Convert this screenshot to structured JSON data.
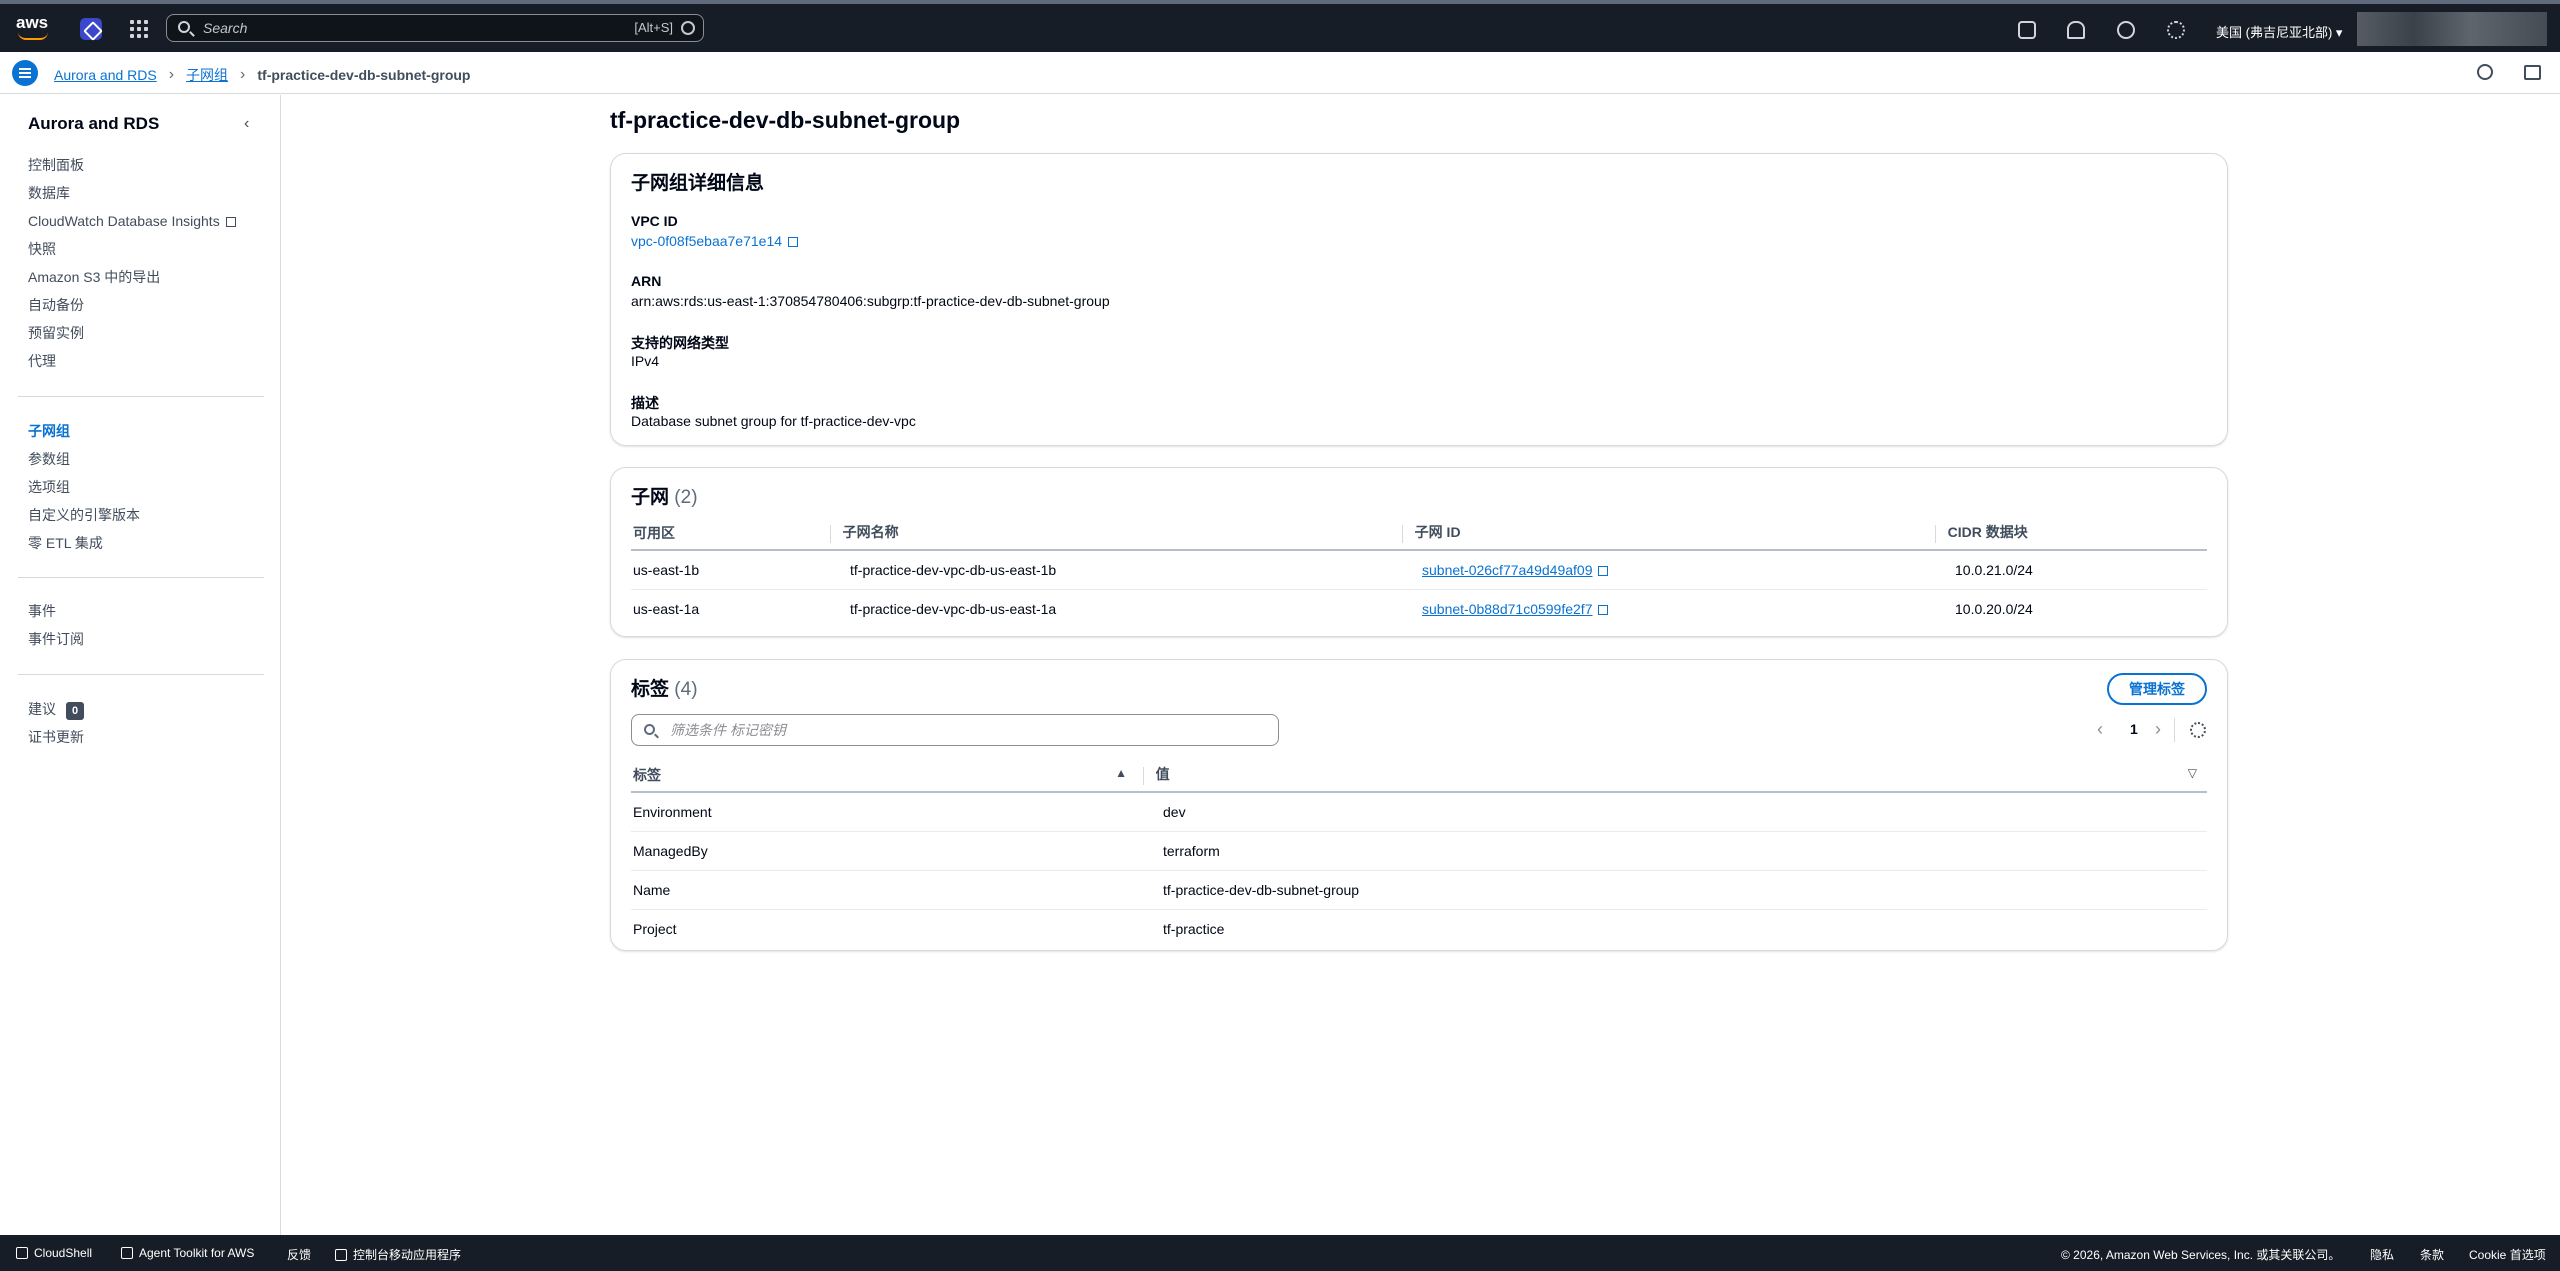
{
  "topnav": {
    "logo_text": "aws",
    "search_placeholder": "Search",
    "search_shortcut": "[Alt+S]",
    "region": "美国 (弗吉尼亚北部)"
  },
  "breadcrumb": {
    "items": [
      "Aurora and RDS",
      "子网组"
    ],
    "current": "tf-practice-dev-db-subnet-group"
  },
  "sidebar": {
    "title": "Aurora and RDS",
    "group1": [
      "控制面板",
      "数据库",
      "CloudWatch Database Insights",
      "快照",
      "Amazon S3 中的导出",
      "自动备份",
      "预留实例",
      "代理"
    ],
    "group2": [
      "子网组",
      "参数组",
      "选项组",
      "自定义的引擎版本",
      "零 ETL 集成"
    ],
    "group3": [
      "事件",
      "事件订阅"
    ],
    "group4": {
      "recommendations": "建议",
      "recommendations_count": "0",
      "cert_update": "证书更新"
    }
  },
  "page": {
    "title": "tf-practice-dev-db-subnet-group"
  },
  "details": {
    "heading": "子网组详细信息",
    "vpc_label": "VPC ID",
    "vpc_value": "vpc-0f08f5ebaa7e71e14",
    "arn_label": "ARN",
    "arn_value": "arn:aws:rds:us-east-1:370854780406:subgrp:tf-practice-dev-db-subnet-group",
    "network_label": "支持的网络类型",
    "network_value": "IPv4",
    "desc_label": "描述",
    "desc_value": "Database subnet group for tf-practice-dev-vpc"
  },
  "subnets": {
    "heading": "子网",
    "count": "(2)",
    "columns": [
      "可用区",
      "子网名称",
      "子网 ID",
      "CIDR 数据块"
    ],
    "rows": [
      {
        "az": "us-east-1b",
        "name": "tf-practice-dev-vpc-db-us-east-1b",
        "id": "subnet-026cf77a49d49af09",
        "cidr": "10.0.21.0/24"
      },
      {
        "az": "us-east-1a",
        "name": "tf-practice-dev-vpc-db-us-east-1a",
        "id": "subnet-0b88d71c0599fe2f7",
        "cidr": "10.0.20.0/24"
      }
    ]
  },
  "tags": {
    "heading": "标签",
    "count": "(4)",
    "manage_label": "管理标签",
    "filter_placeholder": "筛选条件 标记密钥",
    "page": "1",
    "columns": [
      "标签",
      "值"
    ],
    "rows": [
      {
        "key": "Environment",
        "value": "dev"
      },
      {
        "key": "ManagedBy",
        "value": "terraform"
      },
      {
        "key": "Name",
        "value": "tf-practice-dev-db-subnet-group"
      },
      {
        "key": "Project",
        "value": "tf-practice"
      }
    ]
  },
  "footer": {
    "cloudshell": "CloudShell",
    "agent_toolkit": "Agent Toolkit for AWS",
    "feedback": "反馈",
    "mobile_app": "控制台移动应用程序",
    "copyright": "© 2026, Amazon Web Services, Inc. 或其关联公司。",
    "privacy": "隐私",
    "terms": "条款",
    "cookie": "Cookie 首选项"
  }
}
